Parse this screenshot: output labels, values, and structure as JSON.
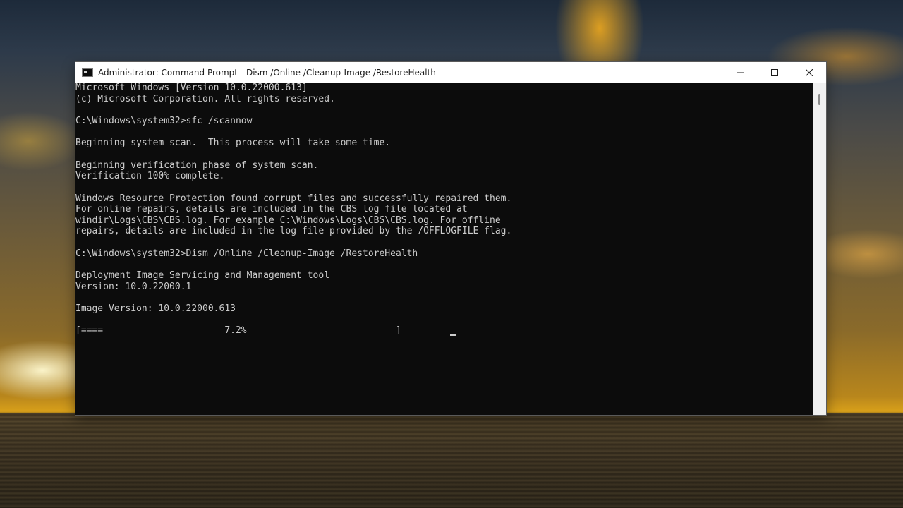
{
  "window": {
    "title": "Administrator: Command Prompt - Dism  /Online /Cleanup-Image /RestoreHealth",
    "icon": "console-icon",
    "controls": [
      "minimize-icon",
      "maximize-icon",
      "close-icon"
    ]
  },
  "console": {
    "lines": [
      "Microsoft Windows [Version 10.0.22000.613]",
      "(c) Microsoft Corporation. All rights reserved.",
      "",
      "C:\\Windows\\system32>sfc /scannow",
      "",
      "Beginning system scan.  This process will take some time.",
      "",
      "Beginning verification phase of system scan.",
      "Verification 100% complete.",
      "",
      "Windows Resource Protection found corrupt files and successfully repaired them.",
      "For online repairs, details are included in the CBS log file located at",
      "windir\\Logs\\CBS\\CBS.log. For example C:\\Windows\\Logs\\CBS\\CBS.log. For offline",
      "repairs, details are included in the log file provided by the /OFFLOGFILE flag.",
      "",
      "C:\\Windows\\system32>Dism /Online /Cleanup-Image /RestoreHealth",
      "",
      "Deployment Image Servicing and Management tool",
      "Version: 10.0.22000.1",
      "",
      "Image Version: 10.0.22000.613",
      "",
      "[====                      7.2%                           ]"
    ],
    "progress_percent": 7.2
  },
  "colors": {
    "console_bg": "#0c0c0c",
    "console_fg": "#cccccc",
    "titlebar_bg": "#ffffff"
  }
}
